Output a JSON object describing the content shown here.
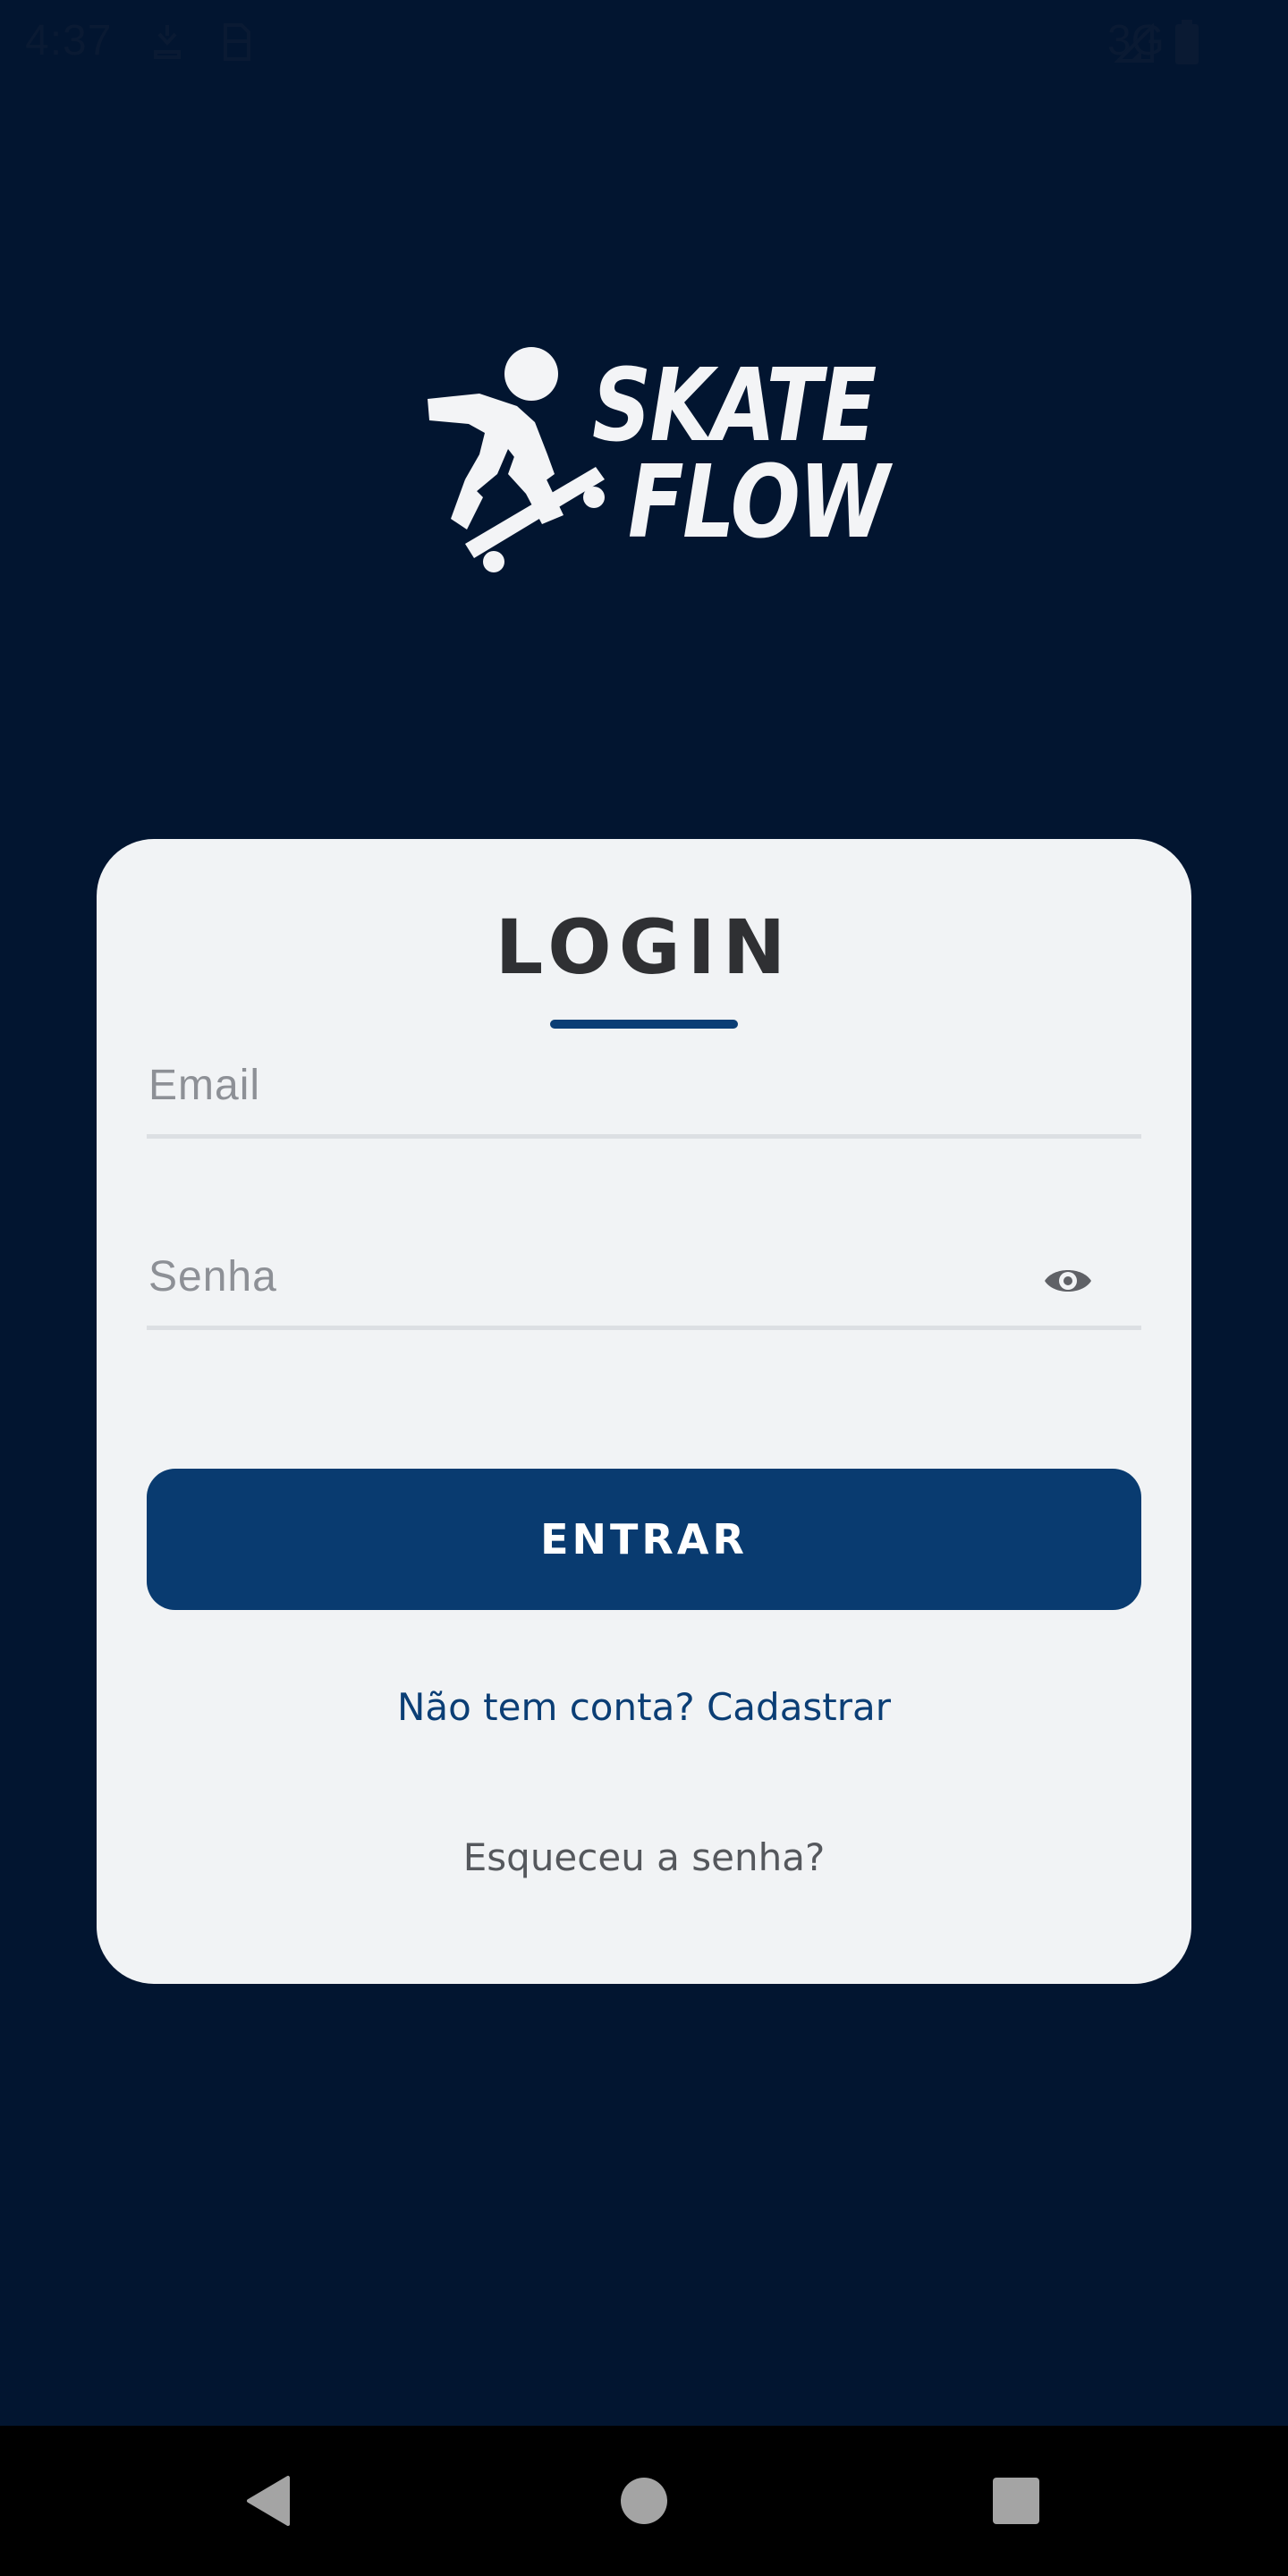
{
  "status_bar": {
    "time": "4:37",
    "network": "3G",
    "icons": [
      "notification-icon",
      "sim-icon",
      "signal-icon",
      "battery-icon"
    ]
  },
  "logo": {
    "line1": "SKATE",
    "line2": "FLOW",
    "icon": "skateboarder-icon"
  },
  "login_card": {
    "title": "LOGIN",
    "email_placeholder": "Email",
    "password_placeholder": "Senha",
    "password_toggle_icon": "eye-icon",
    "enter_label": "ENTRAR",
    "signup_link": "Não tem conta? Cadastrar",
    "forgot_link": "Esqueceu a senha?"
  },
  "nav_bar": {
    "back_icon": "back-triangle-icon",
    "home_icon": "home-circle-icon",
    "recents_icon": "recents-square-icon"
  },
  "colors": {
    "background": "#021530",
    "card": "#f1f3f5",
    "primary": "#093b70",
    "title_text": "#2f3033",
    "link": "#0b3e75",
    "muted_text": "#55585d"
  }
}
